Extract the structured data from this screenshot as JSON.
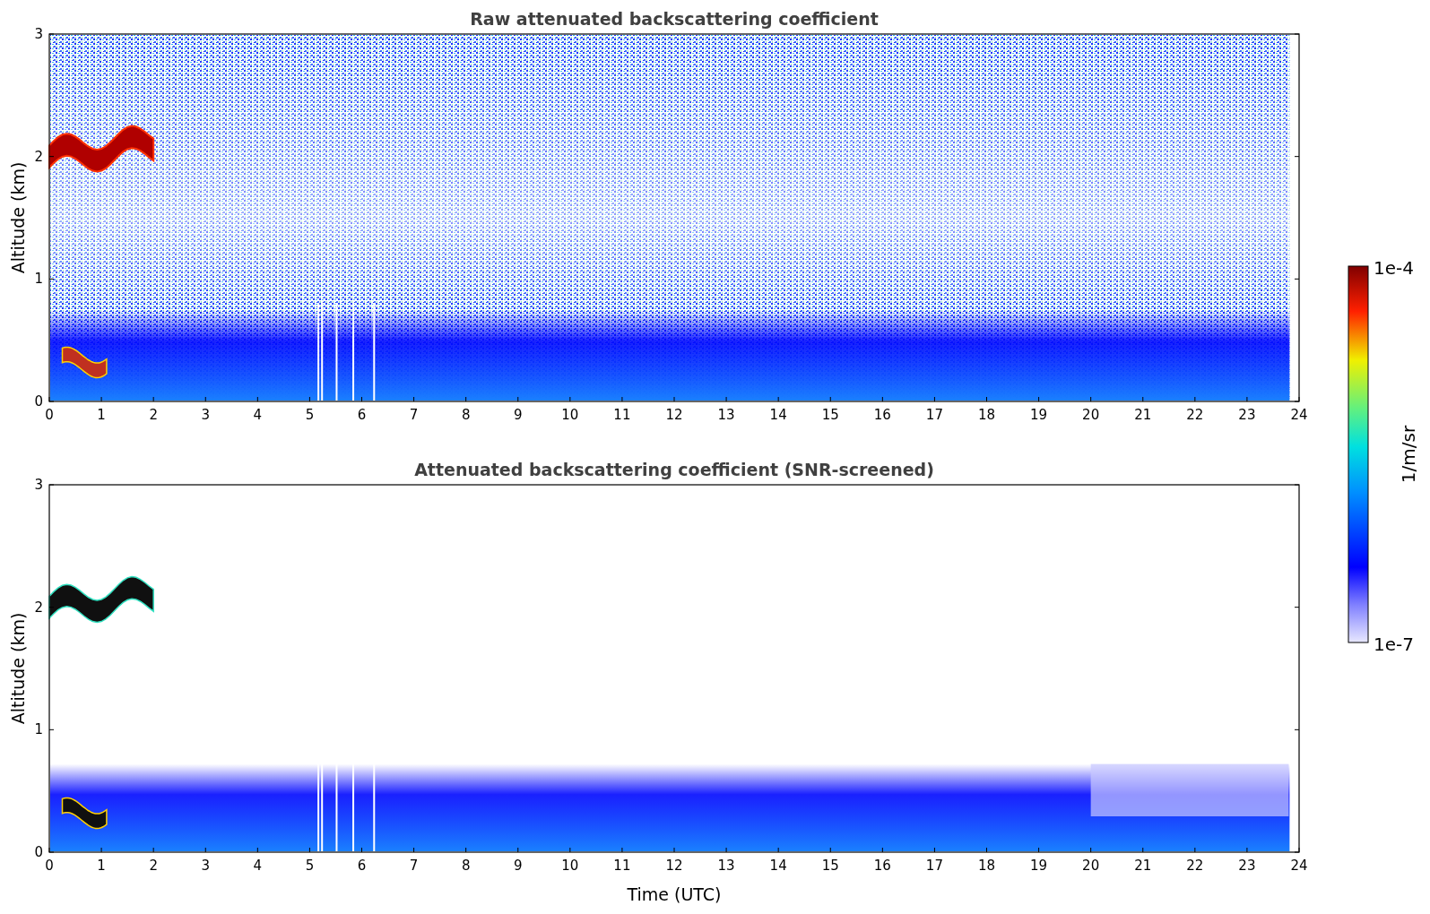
{
  "panels": [
    {
      "kind": "raw",
      "title": "Raw attenuated backscattering coefficient",
      "ylabel": "Altitude (km)",
      "yticks": [
        "3",
        "2",
        "1",
        "0"
      ],
      "xticks": [
        "0",
        "1",
        "2",
        "3",
        "4",
        "5",
        "6",
        "7",
        "8",
        "9",
        "10",
        "11",
        "12",
        "13",
        "14",
        "15",
        "16",
        "17",
        "18",
        "19",
        "20",
        "21",
        "22",
        "23",
        "24"
      ]
    },
    {
      "kind": "screened",
      "title": "Attenuated backscattering coefficient (SNR-screened)",
      "ylabel": "Altitude (km)",
      "yticks": [
        "3",
        "2",
        "1",
        "0"
      ],
      "xticks": [
        "0",
        "1",
        "2",
        "3",
        "4",
        "5",
        "6",
        "7",
        "8",
        "9",
        "10",
        "11",
        "12",
        "13",
        "14",
        "15",
        "16",
        "17",
        "18",
        "19",
        "20",
        "21",
        "22",
        "23",
        "24"
      ]
    }
  ],
  "xlabel": "Time (UTC)",
  "colorbar": {
    "label": "1/m/sr",
    "max_label": "1e-4",
    "min_label": "1e-7"
  }
}
